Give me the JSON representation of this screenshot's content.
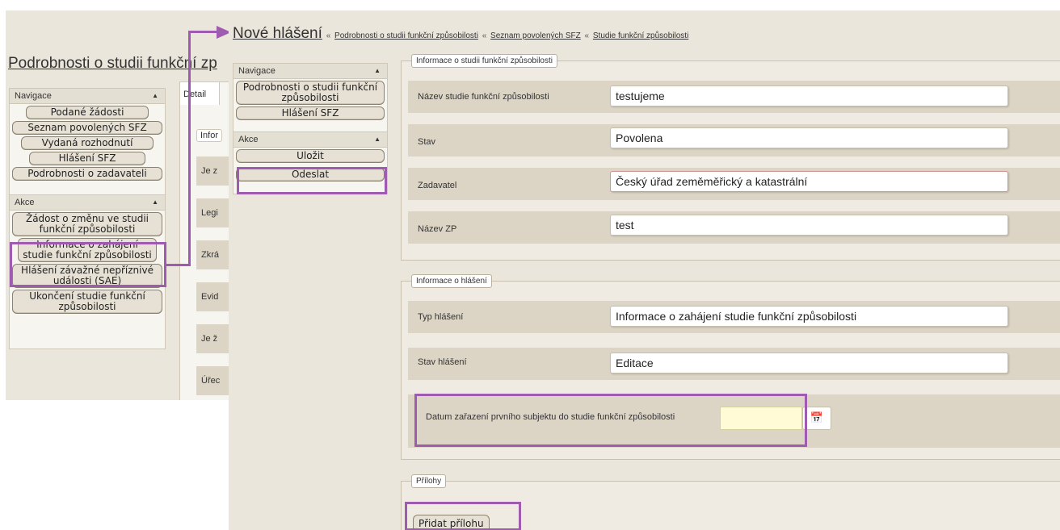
{
  "colors": {
    "highlight": "#9e5bb0",
    "panel_bg": "#ebe6dc",
    "row_bg": "#dcd5c6",
    "date_bg": "#fffbd6"
  },
  "back": {
    "page_title": "Podrobnosti o studii funkční zp",
    "nav": {
      "header": "Navigace",
      "items": [
        "Podané žádosti",
        "Seznam povolených SFZ",
        "Vydaná rozhodnutí",
        "Hlášení SFZ",
        "Podrobnosti o zadavateli"
      ]
    },
    "actions": {
      "header": "Akce",
      "items": [
        "Žádost o změnu ve studii funkční způsobilosti",
        "Informace o zahájení studie funkční způsobilosti",
        "Hlášení závažné nepříznivé události (SAE)",
        "Ukončení studie funkční způsobilosti"
      ]
    },
    "tab_detail": "Detail",
    "legend": "Infor",
    "rows": [
      "Je z",
      "Legi",
      "Zkrá",
      "Evid",
      "Je ž",
      "Úřec"
    ]
  },
  "front": {
    "breadcrumb": {
      "title": "Nové hlášení",
      "separator": "«",
      "links": [
        "Podrobnosti o studii funkční způsobilosti",
        "Seznam povolených SFZ",
        "Studie funkční způsobilosti"
      ]
    },
    "nav": {
      "header": "Navigace",
      "items": [
        "Podrobnosti o studii funkční způsobilosti",
        "Hlášení SFZ"
      ]
    },
    "actions": {
      "header": "Akce",
      "items": [
        "Uložit",
        "Odeslat"
      ]
    },
    "study_info": {
      "legend": "Informace o studii funkční způsobilosti",
      "fields": [
        {
          "label": "Název studie funkční způsobilosti",
          "value": "testujeme"
        },
        {
          "label": "Stav",
          "value": "Povolena"
        },
        {
          "label": "Zadavatel",
          "value": "Český úřad zeměměřický a katastrální"
        },
        {
          "label": "Název ZP",
          "value": "test"
        }
      ]
    },
    "report_info": {
      "legend": "Informace o hlášení",
      "fields": [
        {
          "label": "Typ hlášení",
          "value": "Informace o zahájení studie funkční způsobilosti"
        },
        {
          "label": "Stav hlášení",
          "value": "Editace"
        }
      ],
      "date_label": "Datum zařazení prvního subjektu do studie funkční způsobilosti",
      "date_value": ""
    },
    "attachments": {
      "legend": "Přílohy",
      "add_button": "Přidat přílohu"
    }
  }
}
